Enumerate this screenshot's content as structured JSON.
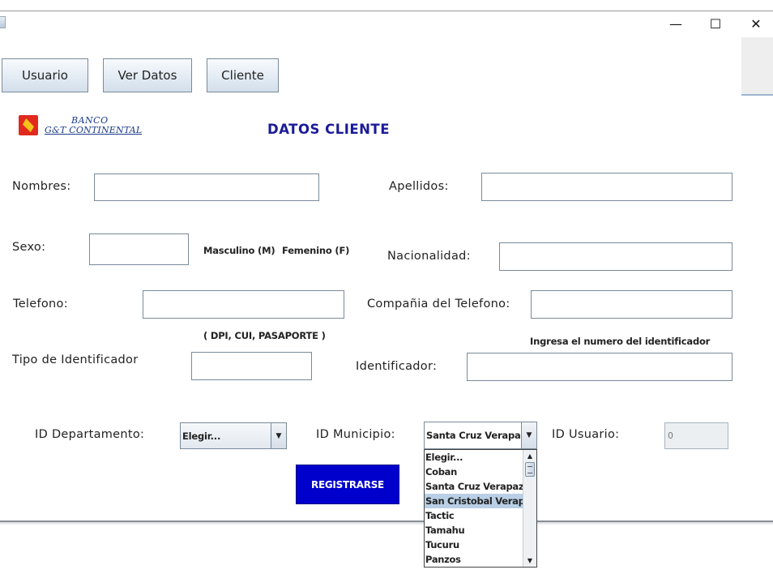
{
  "window": {
    "minimize_glyph": "—",
    "maximize_glyph": "☐",
    "close_glyph": "✕"
  },
  "nav": {
    "usuario": "Usuario",
    "ver_datos": "Ver Datos",
    "cliente": "Cliente"
  },
  "logo": {
    "line1": "BANCO",
    "line2": "G&T CONTINENTAL"
  },
  "form": {
    "title": "DATOS CLIENTE",
    "nombres_label": "Nombres:",
    "apellidos_label": "Apellidos:",
    "sexo_label": "Sexo:",
    "sexo_hint_m": "Masculino (M)",
    "sexo_hint_f": "Femenino (F)",
    "nacionalidad_label": "Nacionalidad:",
    "telefono_label": "Telefono:",
    "compania_label": "Compañia del Telefono:",
    "id_hint": "( DPI, CUI, PASAPORTE )",
    "identificador_hint": "Ingresa el numero del identificador",
    "tipo_label": "Tipo de Identificador",
    "identificador_label": "Identificador:",
    "departamento_label": "ID Departamento:",
    "departamento_value": "Elegir...",
    "municipio_label": "ID Municipio:",
    "municipio_value": "Santa Cruz Verapaz",
    "usuario_label": "ID Usuario:",
    "usuario_value": "0",
    "registrar": "REGISTRARSE"
  },
  "municipio_options": [
    "Elegir...",
    "Coban",
    "Santa Cruz Verapaz",
    "San Cristobal Verapaz",
    "Tactic",
    "Tamahu",
    "Tucuru",
    "Panzos"
  ],
  "municipio_highlighted": "San Cristobal Verapaz",
  "colors": {
    "title": "#1a1a99",
    "register_button": "#0000cc",
    "highlight": "#b8cfe5",
    "logo_red": "#e02a1e",
    "logo_yellow": "#f6c21c"
  }
}
